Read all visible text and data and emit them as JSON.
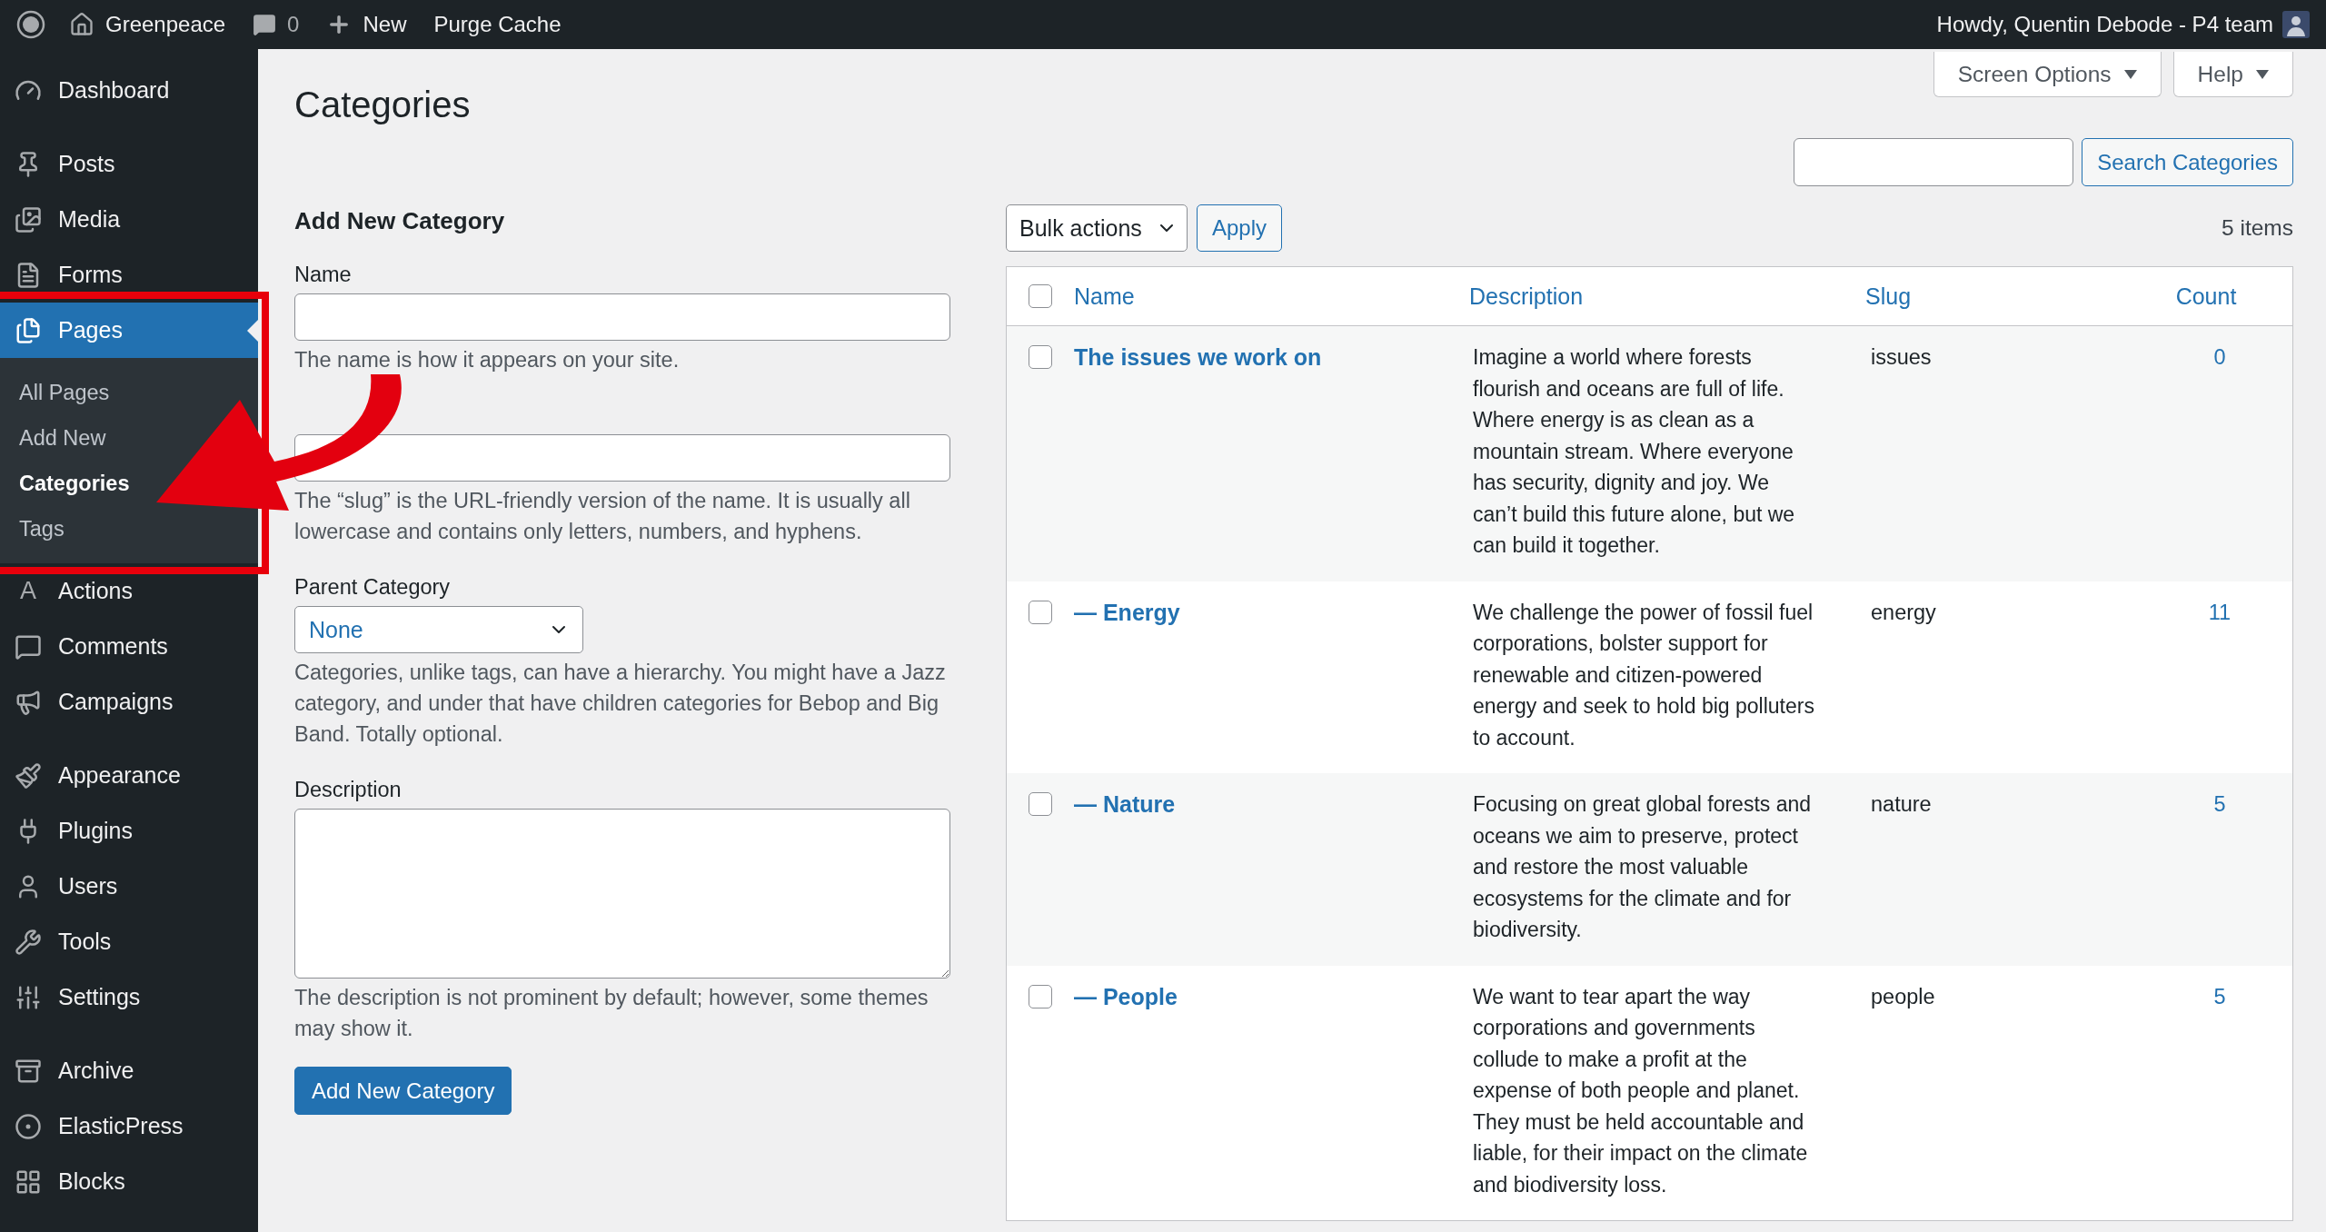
{
  "admin_bar": {
    "site_name": "Greenpeace",
    "comments_count": "0",
    "new_label": "New",
    "purge_label": "Purge Cache",
    "greeting": "Howdy, Quentin Debode - P4 team"
  },
  "sidebar": {
    "groups": [
      [
        {
          "label": "Dashboard",
          "selected": false
        }
      ],
      [
        {
          "label": "Posts",
          "selected": false
        },
        {
          "label": "Media",
          "selected": false
        },
        {
          "label": "Forms",
          "selected": false
        },
        {
          "label": "Pages",
          "selected": true,
          "children": [
            {
              "label": "All Pages",
              "selected": false
            },
            {
              "label": "Add New",
              "selected": false
            },
            {
              "label": "Categories",
              "selected": true
            },
            {
              "label": "Tags",
              "selected": false
            }
          ]
        },
        {
          "label": "Actions",
          "glyph": "A",
          "selected": false
        },
        {
          "label": "Comments",
          "selected": false
        },
        {
          "label": "Campaigns",
          "selected": false
        }
      ],
      [
        {
          "label": "Appearance",
          "selected": false
        },
        {
          "label": "Plugins",
          "selected": false
        },
        {
          "label": "Users",
          "selected": false
        },
        {
          "label": "Tools",
          "selected": false
        },
        {
          "label": "Settings",
          "selected": false
        }
      ],
      [
        {
          "label": "Archive",
          "selected": false
        },
        {
          "label": "ElasticPress",
          "selected": false
        },
        {
          "label": "Blocks",
          "selected": false
        }
      ]
    ]
  },
  "screen_options": "Screen Options",
  "help": "Help",
  "page_title": "Categories",
  "form": {
    "heading": "Add New Category",
    "fields": [
      {
        "kind": "text",
        "label": "Name",
        "hint": "The name is how it appears on your site."
      },
      {
        "kind": "text",
        "hint": "The “slug” is the URL-friendly version of the name. It is usually all lowercase and contains only letters, numbers, and hyphens."
      },
      {
        "kind": "select",
        "label": "Parent Category",
        "value": "None",
        "hint": "Categories, unlike tags, can have a hierarchy. You might have a Jazz category, and under that have children categories for Bebop and Big Band. Totally optional."
      },
      {
        "kind": "textarea",
        "label": "Description",
        "hint": "The description is not prominent by default; however, some themes may show it."
      }
    ],
    "submit": "Add New Category"
  },
  "search": {
    "button": "Search Categories"
  },
  "bulk": {
    "value": "Bulk actions",
    "apply": "Apply",
    "count": "5 items"
  },
  "table": {
    "columns": [
      "Name",
      "Description",
      "Slug",
      "Count"
    ],
    "header_checked": false,
    "rows": [
      {
        "name": "The issues we work on",
        "description": "Imagine a world where forests flourish and oceans are full of life. Where energy is as clean as a mountain stream. Where everyone has security, dignity and joy. We can’t build this future alone, but we can build it together.",
        "slug": "issues",
        "count": "0",
        "checked": false
      },
      {
        "name": "— Energy",
        "description": "We challenge the power of fossil fuel corporations, bolster support for renewable and citizen-powered energy and seek to hold big polluters to account.",
        "slug": "energy",
        "count": "11",
        "checked": false
      },
      {
        "name": "— Nature",
        "description": "Focusing on great global forests and oceans we aim to preserve, protect and restore the most valuable ecosystems for the climate and for biodiversity.",
        "slug": "nature",
        "count": "5",
        "checked": false
      },
      {
        "name": "— People",
        "description": "We want to tear apart the way corporations and governments collude to make a profit at the expense of both people and planet. They must be held accountable and liable, for their impact on the climate and biodiversity loss.",
        "slug": "people",
        "count": "5",
        "checked": false
      }
    ]
  }
}
